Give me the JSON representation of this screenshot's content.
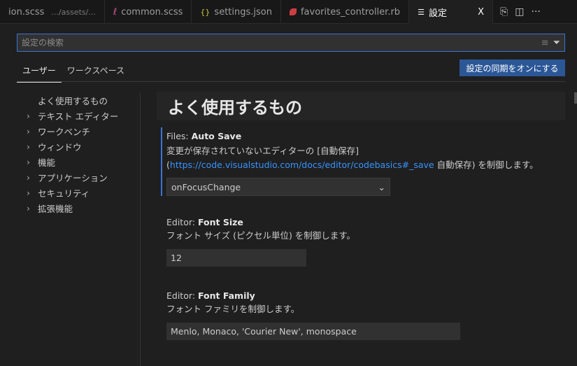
{
  "tabs": [
    {
      "label": "ion.scss",
      "desc": ".../assets/...",
      "icon": "scss-icon"
    },
    {
      "label": "common.scss",
      "icon": "sass-icon"
    },
    {
      "label": "settings.json",
      "icon": "json-braces-icon"
    },
    {
      "label": "favorites_controller.rb",
      "icon": "ruby-icon"
    },
    {
      "label": "設定",
      "icon": "settings-list-icon",
      "close": "X"
    }
  ],
  "actions": {
    "more": "···"
  },
  "search": {
    "placeholder": "設定の検索"
  },
  "scope_tabs": [
    "ユーザー",
    "ワークスペース"
  ],
  "sync_button": "設定の同期をオンにする",
  "toc": [
    "よく使用するもの",
    "テキスト エディター",
    "ワークベンチ",
    "ウィンドウ",
    "機能",
    "アプリケーション",
    "セキュリティ",
    "拡張機能"
  ],
  "section_title": "よく使用するもの",
  "settings": [
    {
      "category": "Files: ",
      "name": "Auto Save",
      "desc1": "変更が保存されていないエディターの [自動保存]",
      "link": "https://code.visualstudio.com/docs/editor/codebasics#_save",
      "link_text": "自動保存",
      "desc2_pre": "(",
      "desc2_post": ") を制御します。",
      "value": "onFocusChange"
    },
    {
      "category": "Editor: ",
      "name": "Font Size",
      "desc": "フォント サイズ (ピクセル単位) を制御します。",
      "value": "12"
    },
    {
      "category": "Editor: ",
      "name": "Font Family",
      "desc": "フォント ファミリを制御します。",
      "value": "Menlo, Monaco, 'Courier New', monospace"
    }
  ],
  "colors": {
    "accent": "#3b74d4",
    "button": "#2b5797",
    "link": "#3794ff"
  }
}
